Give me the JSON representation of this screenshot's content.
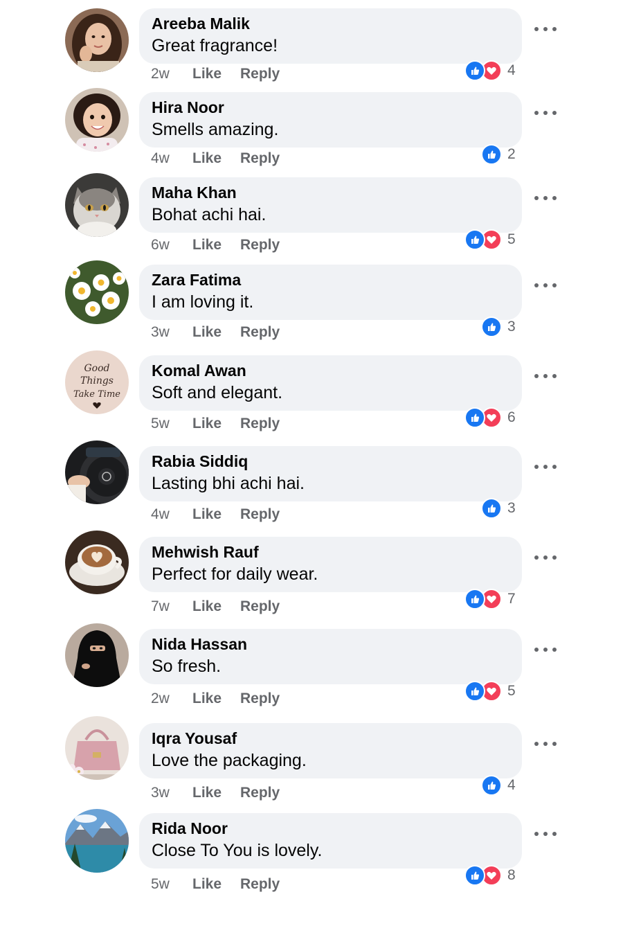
{
  "comments": [
    {
      "name": "Areeba Malik",
      "text": "Great fragrance!",
      "time": "2w",
      "reactions": [
        "like",
        "love"
      ],
      "count": "4",
      "avatar_icon": "girl-portrait"
    },
    {
      "name": "Hira Noor",
      "text": "Smells amazing.",
      "time": "4w",
      "reactions": [
        "like"
      ],
      "count": "2",
      "avatar_icon": "child-portrait"
    },
    {
      "name": "Maha Khan",
      "text": "Bohat achi hai.",
      "time": "6w",
      "reactions": [
        "like",
        "love"
      ],
      "count": "5",
      "avatar_icon": "cat"
    },
    {
      "name": "Zara Fatima",
      "text": "I am loving it.",
      "time": "3w",
      "reactions": [
        "like"
      ],
      "count": "3",
      "avatar_icon": "daisies"
    },
    {
      "name": "Komal Awan",
      "text": "Soft and elegant.",
      "time": "5w",
      "reactions": [
        "like",
        "love"
      ],
      "count": "6",
      "avatar_icon": "quote-card",
      "avatar_text": [
        "Good",
        "Things",
        "Take Time"
      ]
    },
    {
      "name": "Rabia Siddiq",
      "text": "Lasting bhi achi hai.",
      "time": "4w",
      "reactions": [
        "like"
      ],
      "count": "3",
      "avatar_icon": "steering-wheel"
    },
    {
      "name": "Mehwish Rauf",
      "text": "Perfect for daily wear.",
      "time": "7w",
      "reactions": [
        "like",
        "love"
      ],
      "count": "7",
      "avatar_icon": "coffee-cup"
    },
    {
      "name": "Nida Hassan",
      "text": "So fresh.",
      "time": "2w",
      "reactions": [
        "like",
        "love"
      ],
      "count": "5",
      "avatar_icon": "niqab-woman"
    },
    {
      "name": "Iqra Yousaf",
      "text": "Love the packaging.",
      "time": "3w",
      "reactions": [
        "like"
      ],
      "count": "4",
      "avatar_icon": "handbag"
    },
    {
      "name": "Rida Noor",
      "text": "Close To You is lovely.",
      "time": "5w",
      "reactions": [
        "like",
        "love"
      ],
      "count": "8",
      "avatar_icon": "mountain-lake"
    }
  ],
  "labels": {
    "like": "Like",
    "reply": "Reply"
  },
  "colors": {
    "like_blue": "#1877f2",
    "love_red": "#f33e58",
    "bubble": "#f0f2f5",
    "meta_gray": "#65676b"
  }
}
